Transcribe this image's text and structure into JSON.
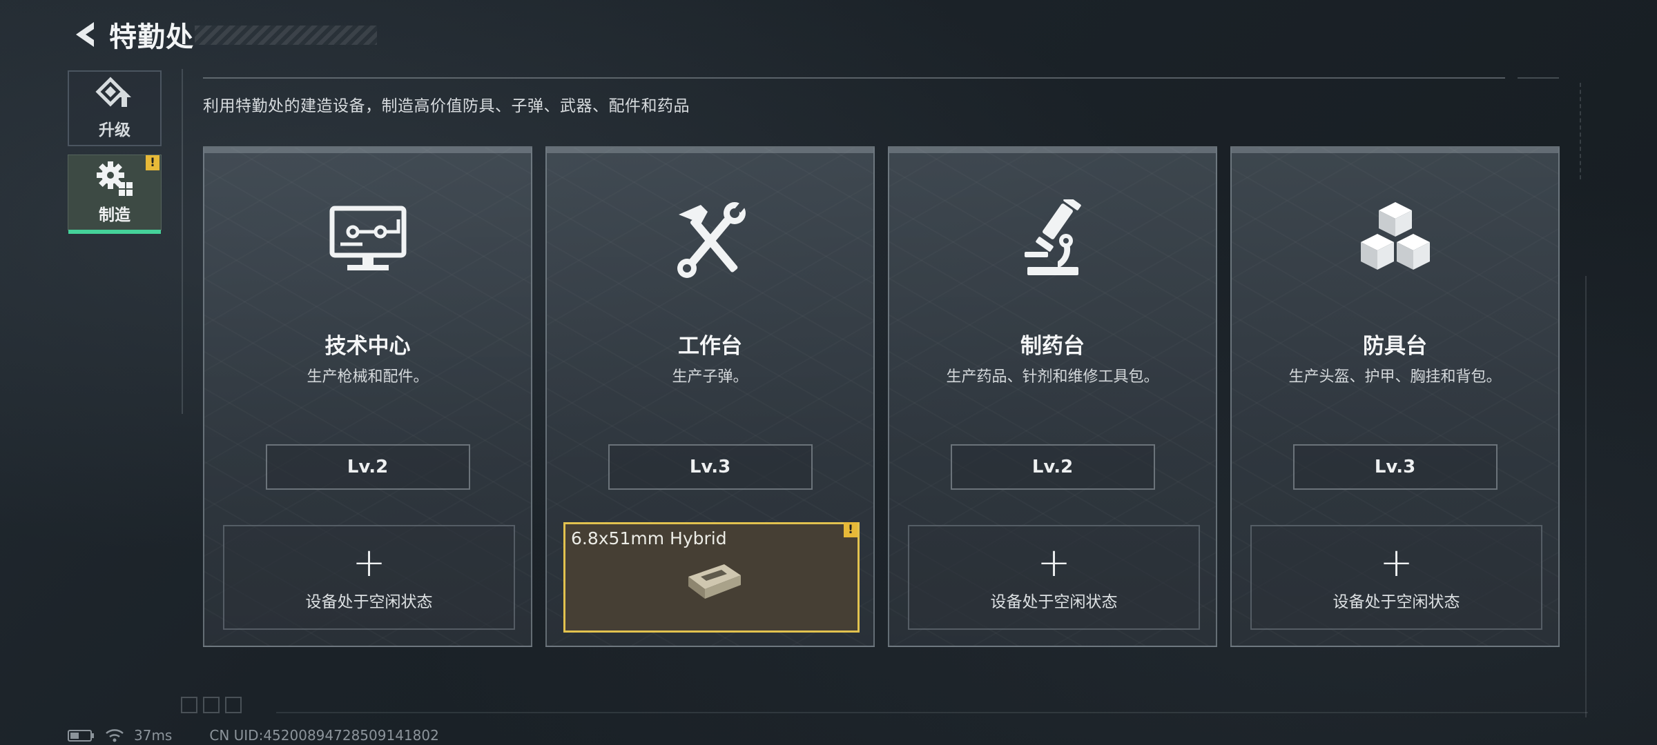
{
  "header": {
    "title": "特勤处"
  },
  "side_tabs": [
    {
      "label": "升级",
      "icon": "upgrade-icon"
    },
    {
      "label": "制造",
      "icon": "craft-gear-icon",
      "active": true,
      "badge": "!"
    }
  ],
  "subtitle": "利用特勤处的建造设备，制造高价值防具、子弹、武器、配件和药品",
  "cards": [
    {
      "name": "技术中心",
      "desc": "生产枪械和配件。",
      "level": "Lv.2",
      "icon": "computer-terminal-icon",
      "slot": {
        "plus": "+",
        "text": "设备处于空闲状态"
      }
    },
    {
      "name": "工作台",
      "desc": "生产子弹。",
      "level": "Lv.3",
      "icon": "hammer-wrench-icon",
      "slot": {
        "item": "6.8x51mm Hybrid",
        "badge": "!"
      }
    },
    {
      "name": "制药台",
      "desc": "生产药品、针剂和维修工具包。",
      "level": "Lv.2",
      "icon": "microscope-icon",
      "slot": {
        "plus": "+",
        "text": "设备处于空闲状态"
      }
    },
    {
      "name": "防具台",
      "desc": "生产头盔、护甲、胸挂和背包。",
      "level": "Lv.3",
      "icon": "cubes-icon",
      "slot": {
        "plus": "+",
        "text": "设备处于空闲状态"
      }
    }
  ],
  "status": {
    "ping": "37ms",
    "uid": "CN UID:45200894728509141802"
  },
  "colors": {
    "accent_green": "#45d29a",
    "warning_yellow": "#e7b938",
    "active_border": "#e2c24f"
  }
}
